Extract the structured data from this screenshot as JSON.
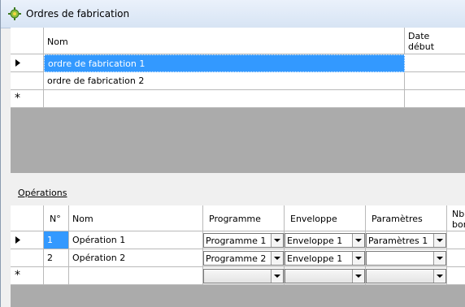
{
  "window": {
    "title": "Ordres de fabrication"
  },
  "orders_grid": {
    "columns": {
      "nom": "Nom",
      "date_debut_line1": "Date",
      "date_debut_line2": "début"
    },
    "rows": [
      {
        "nom": "ordre de fabrication 1"
      },
      {
        "nom": "ordre de fabrication 2"
      }
    ],
    "new_row_marker": "*"
  },
  "operations": {
    "link_label": "Opérations",
    "columns": {
      "num": "N°",
      "nom": "Nom",
      "programme": "Programme",
      "enveloppe": "Enveloppe",
      "parametres": "Paramètres",
      "nbr_line1": "Nbr",
      "nbr_line2": "bon"
    },
    "rows": [
      {
        "num": "1",
        "nom": "Opération 1",
        "programme": "Programme 1",
        "enveloppe": "Enveloppe 1",
        "parametres": "Paramètres 1"
      },
      {
        "num": "2",
        "nom": "Opération 2",
        "programme": "Programme 2",
        "enveloppe": "Enveloppe 1",
        "parametres": ""
      }
    ],
    "new_row_marker": "*"
  },
  "colors": {
    "selection": "#3399ff",
    "grid_background": "#ababab"
  }
}
